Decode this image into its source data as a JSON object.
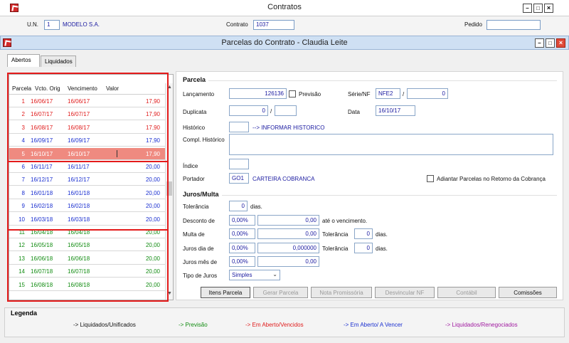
{
  "outer": {
    "title": "Contratos",
    "un_label": "U.N.",
    "un_value": "1",
    "un_name": "MODELO S.A.",
    "contrato_label": "Contrato",
    "contrato_value": "1037",
    "pedido_label": "Pedido",
    "pedido_value": ""
  },
  "inner": {
    "title": "Parcelas do Contrato - Claudia Leite"
  },
  "tabs": [
    {
      "label": "Abertos",
      "active": true
    },
    {
      "label": "Liquidados",
      "active": false
    }
  ],
  "grid": {
    "headers": [
      "Parcela",
      "Vcto. Orig",
      "Vencimento",
      "Valor"
    ],
    "rows": [
      {
        "parcela": "1",
        "orig": "16/06/17",
        "venc": "16/06/17",
        "valor": "17,90",
        "status": "red"
      },
      {
        "parcela": "2",
        "orig": "16/07/17",
        "venc": "16/07/17",
        "valor": "17,90",
        "status": "red"
      },
      {
        "parcela": "3",
        "orig": "16/08/17",
        "venc": "16/08/17",
        "valor": "17,90",
        "status": "red"
      },
      {
        "parcela": "4",
        "orig": "16/09/17",
        "venc": "16/09/17",
        "valor": "17,90",
        "status": "blue"
      },
      {
        "parcela": "5",
        "orig": "16/10/17",
        "venc": "16/10/17",
        "valor": "17,90",
        "status": "selected"
      },
      {
        "parcela": "6",
        "orig": "16/11/17",
        "venc": "16/11/17",
        "valor": "20,00",
        "status": "blue"
      },
      {
        "parcela": "7",
        "orig": "16/12/17",
        "venc": "16/12/17",
        "valor": "20,00",
        "status": "blue"
      },
      {
        "parcela": "8",
        "orig": "16/01/18",
        "venc": "16/01/18",
        "valor": "20,00",
        "status": "blue"
      },
      {
        "parcela": "9",
        "orig": "16/02/18",
        "venc": "16/02/18",
        "valor": "20,00",
        "status": "blue"
      },
      {
        "parcela": "10",
        "orig": "16/03/18",
        "venc": "16/03/18",
        "valor": "20,00",
        "status": "blue"
      },
      {
        "parcela": "11",
        "orig": "16/04/18",
        "venc": "16/04/18",
        "valor": "20,00",
        "status": "green"
      },
      {
        "parcela": "12",
        "orig": "16/05/18",
        "venc": "16/05/18",
        "valor": "20,00",
        "status": "green"
      },
      {
        "parcela": "13",
        "orig": "16/06/18",
        "venc": "16/06/18",
        "valor": "20,00",
        "status": "green"
      },
      {
        "parcela": "14",
        "orig": "16/07/18",
        "venc": "16/07/18",
        "valor": "20,00",
        "status": "green"
      },
      {
        "parcela": "15",
        "orig": "16/08/18",
        "venc": "16/08/18",
        "valor": "20,00",
        "status": "green"
      }
    ]
  },
  "parcela": {
    "section_title": "Parcela",
    "lancamento_label": "Lançamento",
    "lancamento_value": "126136",
    "previsao_label": "Previsão",
    "serie_label": "Série/NF",
    "serie_value": "NFE2",
    "slash": "/",
    "nf_value": "0",
    "duplicata_label": "Duplicata",
    "duplicata_value": "0",
    "duplicata_value2": "",
    "data_label": "Data",
    "data_value": "16/10/17",
    "historico_label": "Histórico",
    "historico_code": "",
    "historico_text": "--> INFORMAR HISTORICO",
    "compl_label": "Compl. Histórico",
    "compl_value": "",
    "indice_label": "Índice",
    "indice_value": "",
    "portador_label": "Portador",
    "portador_code": "GO1",
    "portador_name": "CARTEIRA COBRANCA",
    "adiantar_label": "Adiantar Parcelas no Retorno da Cobrança"
  },
  "juros": {
    "section_title": "Juros/Multa",
    "tolerancia_label": "Tolerância",
    "tolerancia_value": "0",
    "dias": "dias.",
    "desconto_label": "Desconto de",
    "desconto_pct": "0,00%",
    "desconto_val": "0,00",
    "ate_venc": "até o vencimento.",
    "multa_label": "Multa de",
    "multa_pct": "0,00%",
    "multa_val": "0,00",
    "multa_tol_label": "Tolerância",
    "multa_tol_value": "0",
    "juros_dia_label": "Juros dia de",
    "juros_dia_pct": "0,00%",
    "juros_dia_val": "0,000000",
    "juros_tol_label": "Tolerância",
    "juros_tol_value": "0",
    "juros_mes_label": "Juros mês de",
    "juros_mes_pct": "0,00%",
    "juros_mes_val": "0,00",
    "tipo_label": "Tipo de Juros",
    "tipo_value": "Simples"
  },
  "buttons": {
    "itens": "Itens Parcela",
    "gerar": "Gerar Parcela",
    "nota": "Nota Promissória",
    "desvincular": "Desvincular NF",
    "contabil": "Contábil",
    "comissoes": "Comissões"
  },
  "legend": {
    "title": "Legenda",
    "items": [
      {
        "label": "-> Liquidados/Unificados",
        "color": "#111111"
      },
      {
        "label": "-> Previsão",
        "color": "#128c12"
      },
      {
        "label": "-> Em Aberto/Vencidos",
        "color": "#e01b1b"
      },
      {
        "label": "-> Em Aberto/ A Vencer",
        "color": "#1a2fd0"
      },
      {
        "label": "-> Liquidados/Renegociados",
        "color": "#a01aa0"
      }
    ]
  },
  "colors": {
    "highlight_box": "#e41b1b",
    "selected_row": "#ef8a80",
    "title_bar": "#cfe0f3"
  }
}
